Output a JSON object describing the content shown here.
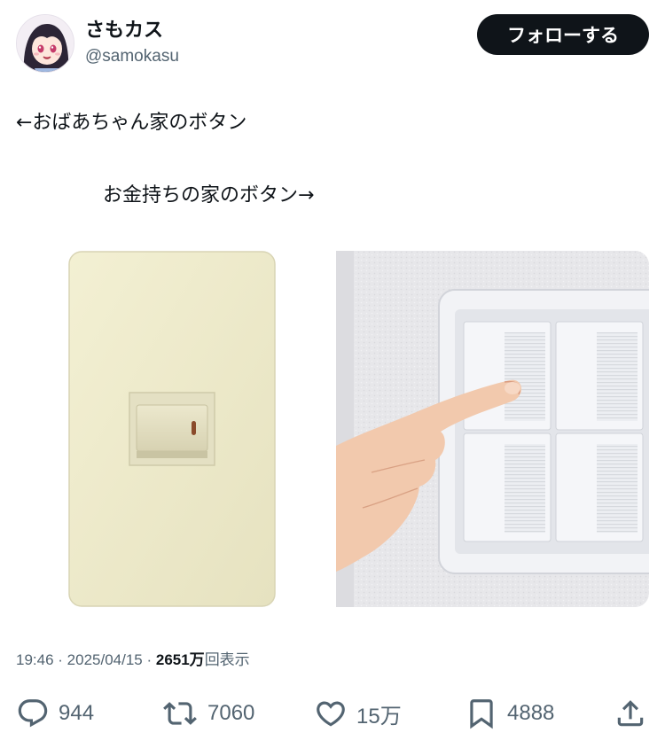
{
  "author": {
    "display_name": "さもカス",
    "handle": "@samokasu"
  },
  "follow_button": {
    "label": "フォローする"
  },
  "tweet": {
    "line1": "←おばあちゃん家のボタン",
    "line2": "お金持ちの家のボタン→"
  },
  "meta": {
    "time": "19:46",
    "separator1": " · ",
    "date": "2025/04/15",
    "separator2": " · ",
    "views_count": "2651万",
    "views_label": "回表示"
  },
  "actions": {
    "replies": "944",
    "reposts": "7060",
    "likes": "15万",
    "bookmarks": "4888"
  },
  "colors": {
    "text": "#0f1419",
    "secondary": "#536471",
    "follow_bg": "#0f1419",
    "old_switch_plate": "#efeccc",
    "modern_switch_plate": "#f4f5f8"
  },
  "icons": [
    "reply-icon",
    "repost-icon",
    "like-icon",
    "bookmark-icon",
    "share-icon"
  ]
}
